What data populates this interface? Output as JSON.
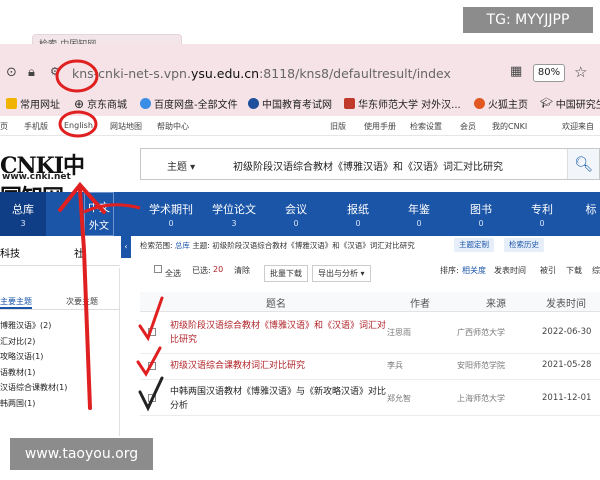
{
  "watermarks": {
    "top": "TG: MYYJJPP",
    "bottom": "www.taoyou.org"
  },
  "browser": {
    "tab_title": "检索-中国知网",
    "url_pre": "kns-cnki-net-s.vpn.",
    "url_domain": "ysu.edu.cn",
    "url_post": ":8118/kns8/defaultresult/index",
    "zoom": "80%",
    "bookmarks": [
      {
        "label": "常用网址",
        "color": "#f0b400"
      },
      {
        "label": "京东商城",
        "color": "#333333"
      },
      {
        "label": "百度网盘-全部文件",
        "color": "#3a8ee6"
      },
      {
        "label": "中国教育考试网",
        "color": "#1d4f9c"
      },
      {
        "label": "华东师范大学 对外汉...",
        "color": "#c0392b"
      },
      {
        "label": "火狐主页",
        "color": "#e25822"
      },
      {
        "label": "中国研究生",
        "color": "#333333"
      }
    ]
  },
  "cnki_topbar": [
    "页",
    "手机版",
    "English",
    "网站地图",
    "帮助中心",
    "旧版",
    "使用手册",
    "检索设置",
    "会员",
    "我的CNKI",
    "欢迎来自"
  ],
  "logo": {
    "main": "CNKI中国知网",
    "url": "www.cnki.net"
  },
  "search": {
    "field": "主题",
    "query": "初级阶段汉语综合教材《博雅汉语》和《汉语》词汇对比研究"
  },
  "nav": [
    {
      "label": "总库",
      "count": "3"
    },
    {
      "label": "中文",
      "count": ""
    },
    {
      "label": "学术期刊",
      "count": "0"
    },
    {
      "label": "学位论文",
      "count": "3"
    },
    {
      "label": "会议",
      "count": "0"
    },
    {
      "label": "报纸",
      "count": "0"
    },
    {
      "label": "年鉴",
      "count": "0"
    },
    {
      "label": "图书",
      "count": "0"
    },
    {
      "label": "专利",
      "count": "0"
    },
    {
      "label": "标",
      "count": ""
    }
  ],
  "nav_sub": "外文",
  "sidebar": {
    "heads": [
      "科技",
      "社"
    ],
    "tabs": [
      "主要主题",
      "次要主题"
    ],
    "items": [
      "博雅汉语》(2)",
      "汇对比(2)",
      "攻略汉语(1)",
      "语教材(1)",
      "汉语综合课教材(1)",
      "韩两国(1)"
    ]
  },
  "crumb": {
    "label": "检索范围:",
    "scope": "总库",
    "detail": "主题: 初级阶段汉语综合教材《博雅汉语》和《汉语》词汇对比研究",
    "tag1": "主题定制",
    "tag2": "检索历史"
  },
  "toolbar": {
    "select_all": "全选",
    "selected_label": "已选:",
    "selected_count": "20",
    "clear": "清除",
    "batch": "批量下载",
    "export": "导出与分析 ▾",
    "sort_label": "排序:",
    "sort_relevance": "相关度",
    "sort_time": "发表时间",
    "sort_cited": "被引",
    "sort_download": "下载",
    "more": "综"
  },
  "table": {
    "headers": [
      "题名",
      "作者",
      "来源",
      "发表时间"
    ],
    "rows": [
      {
        "title": "初级阶段汉语综合教材《博雅汉语》和《汉语》词汇对比研究",
        "author": "汪思雨",
        "source": "广西师范大学",
        "date": "2022-06-30",
        "red": true
      },
      {
        "title": "初级汉语综合课教材词汇对比研究",
        "author": "李兵",
        "source": "安阳师范学院",
        "date": "2021-05-28",
        "red": true
      },
      {
        "title": "中韩两国汉语教材《博雅汉语》与《新攻略汉语》对比分析",
        "author": "郑允智",
        "source": "上海师范大学",
        "date": "2011-12-01",
        "red": false
      }
    ]
  },
  "colors": {
    "nav_bg": "#1b55a8",
    "browser_bg": "#f5e3e8",
    "highlight_red": "#b0242a",
    "annotation_red": "#e02020"
  }
}
